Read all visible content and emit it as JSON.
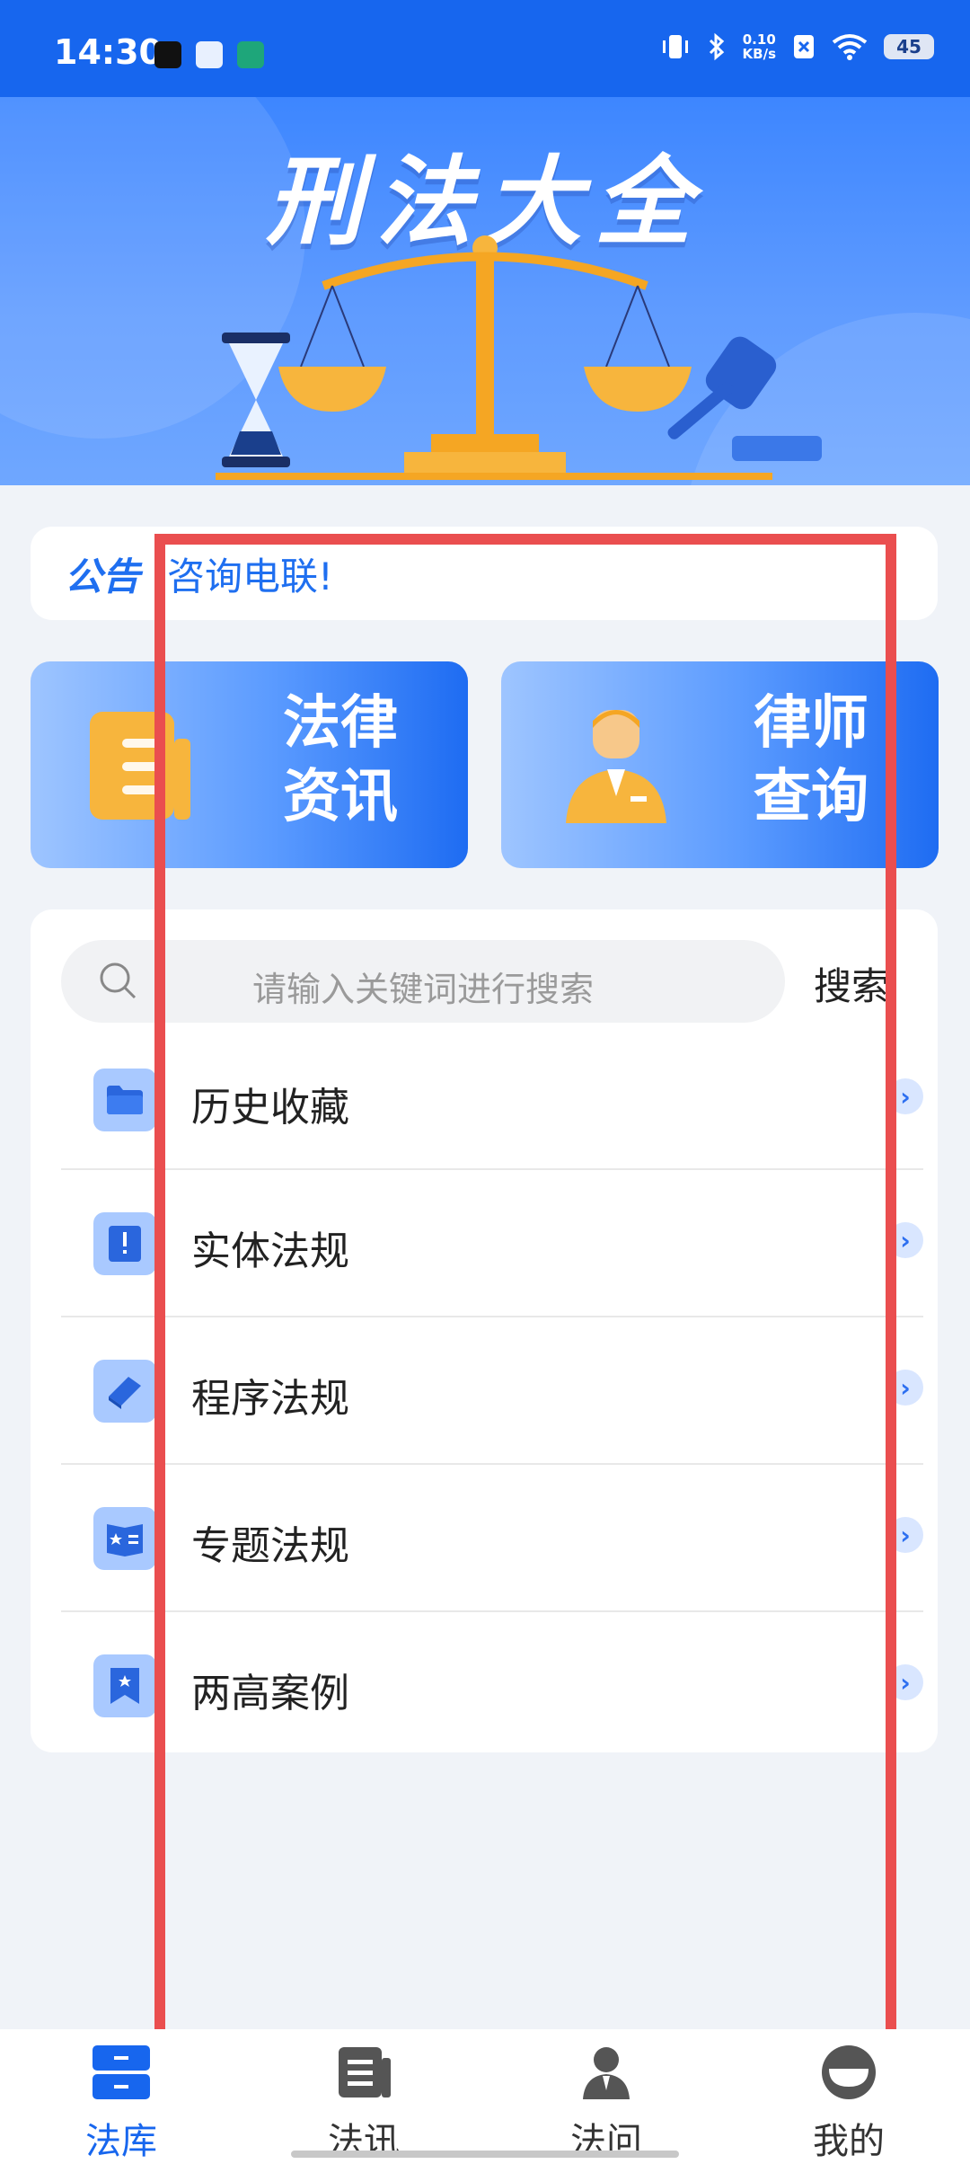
{
  "status_bar": {
    "time": "14:30",
    "net_speed_value": "0.10",
    "net_speed_unit": "KB/s",
    "battery": "45"
  },
  "banner": {
    "title": "刑法大全"
  },
  "notice": {
    "tag": "公告",
    "text": "咨询电联!"
  },
  "cards": [
    {
      "label": "法律资讯",
      "icon": "document-icon"
    },
    {
      "label": "律师查询",
      "icon": "lawyer-icon"
    }
  ],
  "search": {
    "placeholder": "请输入关键词进行搜索",
    "button_label": "搜索"
  },
  "list": [
    {
      "label": "历史收藏",
      "icon": "folder-icon"
    },
    {
      "label": "实体法规",
      "icon": "book-alert-icon"
    },
    {
      "label": "程序法规",
      "icon": "notebook-icon"
    },
    {
      "label": "专题法规",
      "icon": "star-book-icon"
    },
    {
      "label": "两高案例",
      "icon": "bookmark-star-icon"
    }
  ],
  "bottom_nav": [
    {
      "label": "法库",
      "active": true
    },
    {
      "label": "法讯",
      "active": false
    },
    {
      "label": "法问",
      "active": false
    },
    {
      "label": "我的",
      "active": false
    }
  ],
  "colors": {
    "primary": "#1766ee",
    "highlight": "#ea4e4f",
    "icon_bg": "#a9c9ff"
  }
}
